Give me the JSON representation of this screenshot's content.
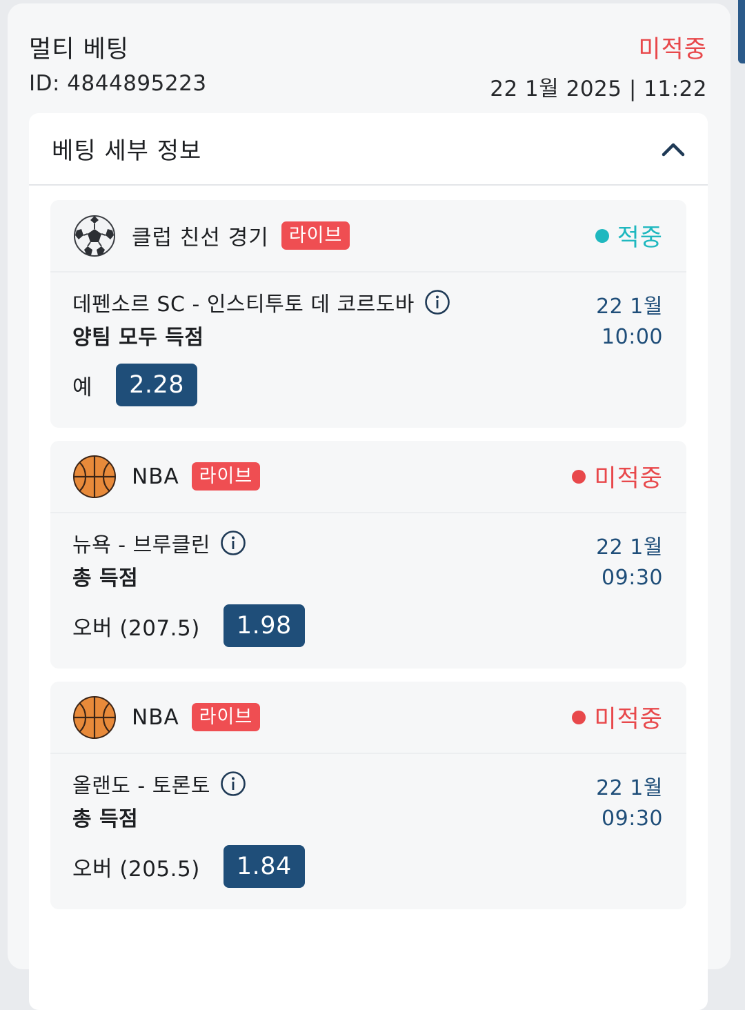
{
  "bet": {
    "title": "멀티 베팅",
    "status": "미적중",
    "id_text": "ID: 4844895223",
    "datetime": "22 1월 2025 | 11:22"
  },
  "details": {
    "title": "베팅 세부 정보"
  },
  "events": [
    {
      "sport_icon": "soccer-ball-icon",
      "league": "클럽 친선 경기",
      "live": "라이브",
      "status": "적중",
      "match": "데펜소르 SC - 인스티투토 데 코르도바",
      "market": "양팀 모두 득점",
      "pick": "예",
      "odds": "2.28",
      "date": "22 1월",
      "time": "10:00"
    },
    {
      "sport_icon": "basketball-icon",
      "league": "NBA",
      "live": "라이브",
      "status": "미적중",
      "match": "뉴욕 - 브루클린",
      "market": "총 득점",
      "pick": "오버 (207.5)",
      "odds": "1.98",
      "date": "22 1월",
      "time": "09:30"
    },
    {
      "sport_icon": "basketball-icon",
      "league": "NBA",
      "live": "라이브",
      "status": "미적중",
      "match": "올랜도 - 토론토",
      "market": "총 득점",
      "pick": "오버 (205.5)",
      "odds": "1.84",
      "date": "22 1월",
      "time": "09:30"
    }
  ],
  "colors": {
    "win": "#1fb8bf",
    "lose": "#e8484b",
    "live_badge": "#ef4e52",
    "odds_bg": "#1f4e79"
  }
}
